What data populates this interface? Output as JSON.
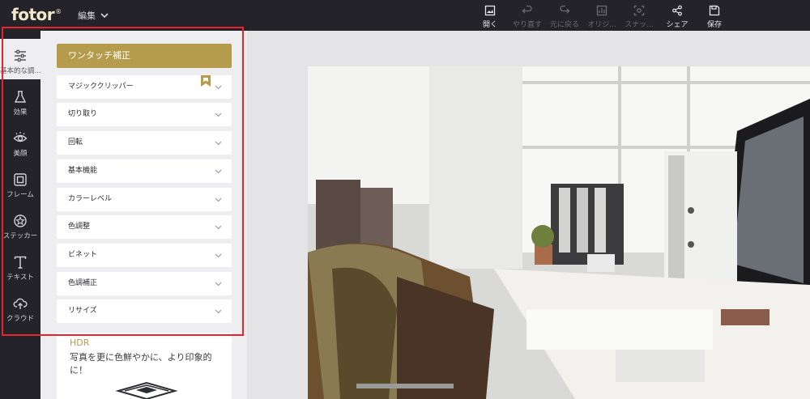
{
  "app": {
    "logo_text": "fotor",
    "logo_mark": "®"
  },
  "menu": {
    "edit_label": "編集"
  },
  "toolbar": {
    "items": [
      {
        "label": "開く",
        "icon": "open-image-icon",
        "enabled": true
      },
      {
        "label": "やり直す",
        "icon": "undo-icon",
        "enabled": false
      },
      {
        "label": "元に戻る",
        "icon": "redo-icon",
        "enabled": false
      },
      {
        "label": "オリジ...",
        "icon": "original-icon",
        "enabled": false
      },
      {
        "label": "スナッ...",
        "icon": "snapshot-icon",
        "enabled": false
      },
      {
        "label": "シェア",
        "icon": "share-icon",
        "enabled": true
      },
      {
        "label": "保存",
        "icon": "save-icon",
        "enabled": true
      }
    ]
  },
  "rail": {
    "items": [
      {
        "label": "基本的な調...",
        "icon": "sliders-icon",
        "active": true
      },
      {
        "label": "効果",
        "icon": "flask-icon",
        "active": false
      },
      {
        "label": "美顔",
        "icon": "eye-icon",
        "active": false
      },
      {
        "label": "フレーム",
        "icon": "frame-icon",
        "active": false
      },
      {
        "label": "ステッカー",
        "icon": "sticker-icon",
        "active": false
      },
      {
        "label": "テキスト",
        "icon": "text-icon",
        "active": false
      },
      {
        "label": "クラウド",
        "icon": "cloud-upload-icon",
        "active": false
      }
    ]
  },
  "panel": {
    "one_touch_label": "ワンタッチ補正",
    "items": [
      {
        "label": "マジッククリッパー"
      },
      {
        "label": "切り取り"
      },
      {
        "label": "回転"
      },
      {
        "label": "基本機能"
      },
      {
        "label": "カラーレベル"
      },
      {
        "label": "色調整"
      },
      {
        "label": "ビネット"
      },
      {
        "label": "色調補正"
      },
      {
        "label": "リサイズ"
      }
    ],
    "hdr": {
      "title": "HDR",
      "description": "写真を更に色鮮やかに、より印象的に！"
    }
  },
  "colors": {
    "topbar": "#232329",
    "accent_gold": "#b59c4c",
    "highlight_red": "#e8232a",
    "panel_bg": "#eeeef1"
  }
}
